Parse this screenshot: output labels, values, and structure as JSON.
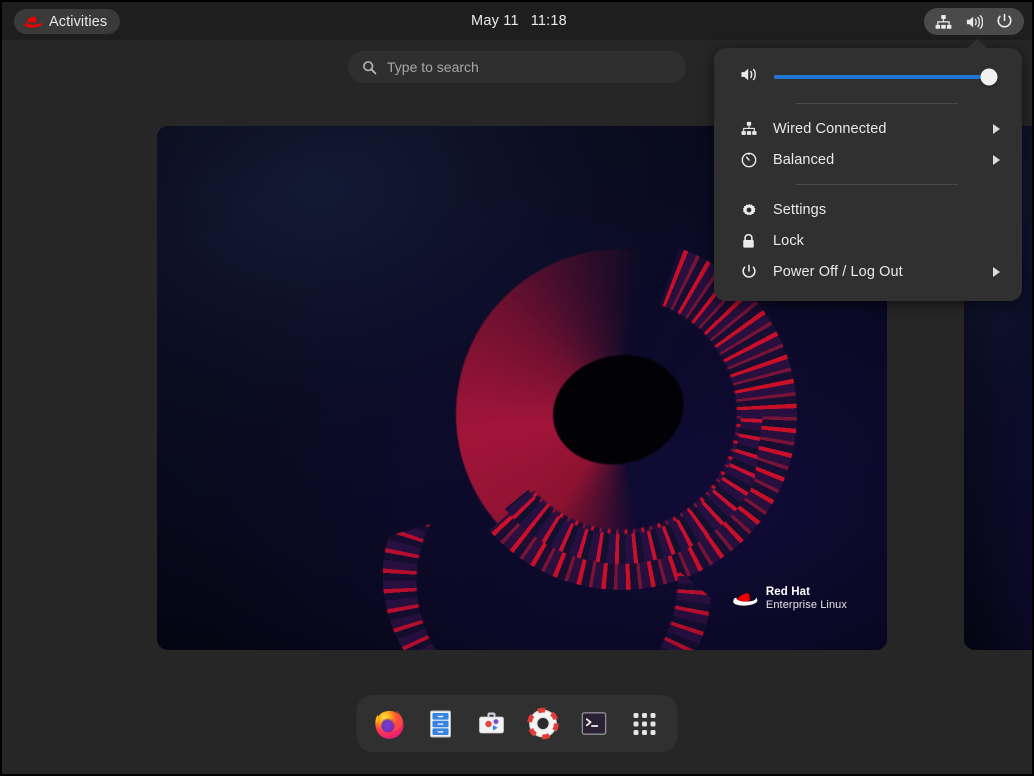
{
  "topbar": {
    "activities_label": "Activities",
    "clock_date": "May 11",
    "clock_time": "11:18",
    "status_icons": [
      "network-wired-icon",
      "volume-icon",
      "power-icon"
    ]
  },
  "overview": {
    "search_placeholder": "Type to search"
  },
  "wallpaper": {
    "brand_line1": "Red Hat",
    "brand_line2": "Enterprise Linux"
  },
  "dash": {
    "items": [
      {
        "name": "firefox",
        "label": "Firefox"
      },
      {
        "name": "files",
        "label": "Files"
      },
      {
        "name": "software",
        "label": "Software"
      },
      {
        "name": "help",
        "label": "Help"
      },
      {
        "name": "terminal",
        "label": "Terminal"
      },
      {
        "name": "show-apps",
        "label": "Show Applications"
      }
    ]
  },
  "system_menu": {
    "volume": {
      "icon": "volume-icon",
      "value": 96
    },
    "items": [
      {
        "label": "Wired Connected",
        "icon": "network-wired-icon",
        "submenu": true
      },
      {
        "label": "Balanced",
        "icon": "power-profile-icon",
        "submenu": true
      },
      {
        "label": "Settings",
        "icon": "gear-icon",
        "submenu": false
      },
      {
        "label": "Lock",
        "icon": "lock-icon",
        "submenu": false
      },
      {
        "label": "Power Off / Log Out",
        "icon": "power-icon",
        "submenu": true
      }
    ]
  },
  "colors": {
    "accent_blue": "#1f76d2",
    "panel_bg": "#1e1e1e",
    "menu_bg": "#303030",
    "desktop_bg": "#262626",
    "redhat_red": "#e00"
  }
}
